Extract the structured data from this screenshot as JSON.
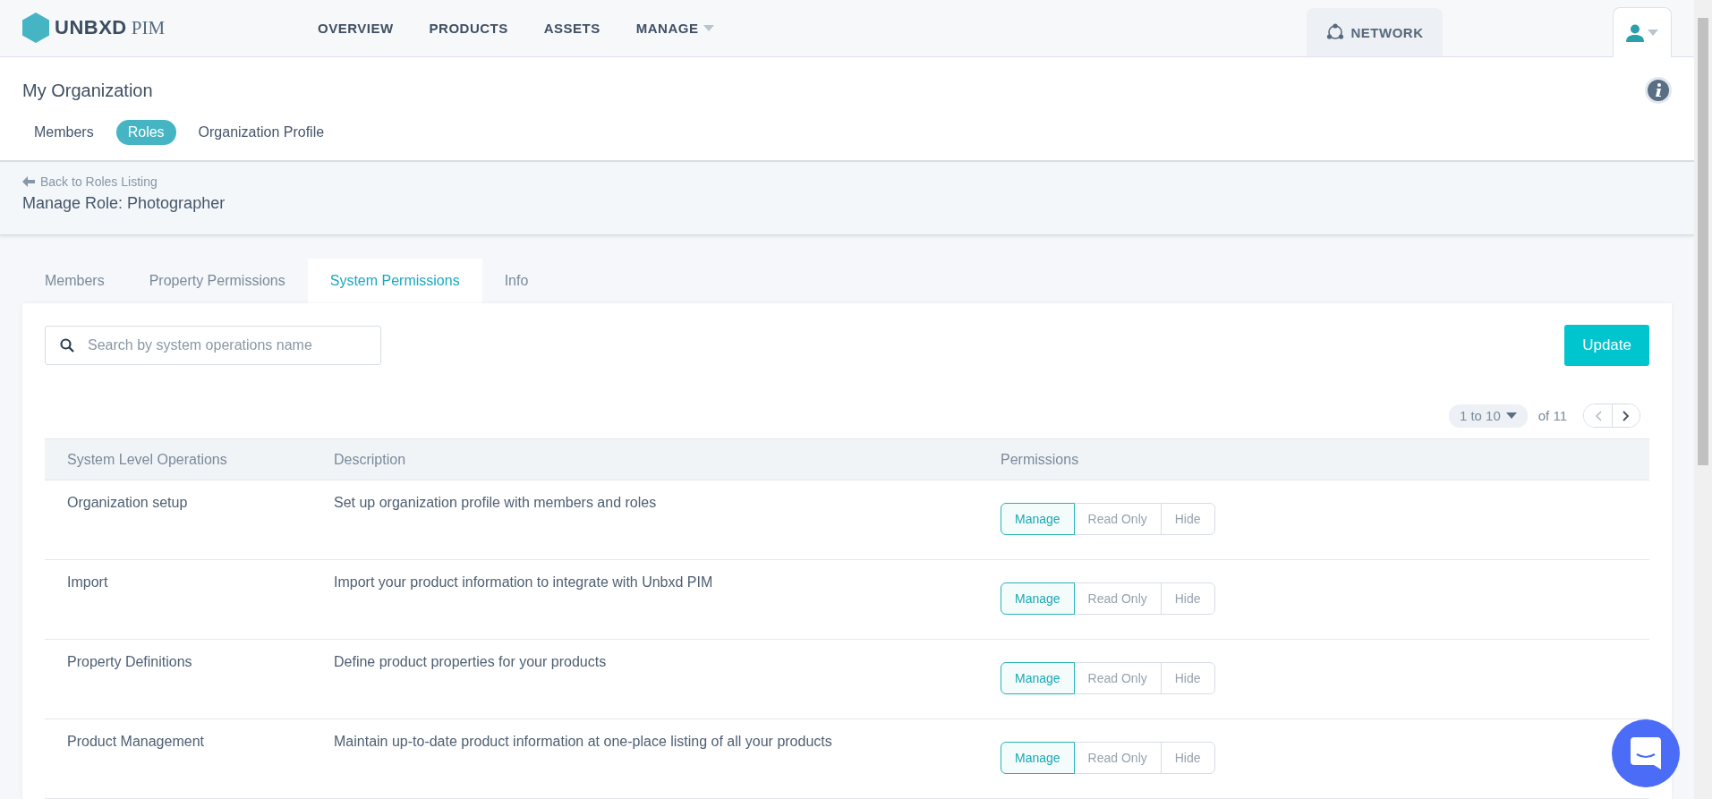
{
  "brand": {
    "name": "UNBXD",
    "suffix": "PIM"
  },
  "nav": [
    {
      "label": "OVERVIEW",
      "dropdown": false
    },
    {
      "label": "PRODUCTS",
      "dropdown": false
    },
    {
      "label": "ASSETS",
      "dropdown": false
    },
    {
      "label": "MANAGE",
      "dropdown": true
    }
  ],
  "network": {
    "label": "NETWORK"
  },
  "page_title": "My Organization",
  "org_tabs": [
    {
      "label": "Members",
      "selected": false
    },
    {
      "label": "Roles",
      "selected": true
    },
    {
      "label": "Organization Profile",
      "selected": false
    }
  ],
  "back_link": "Back to Roles Listing",
  "role_title": "Manage Role: Photographer",
  "role_tabs": [
    {
      "label": "Members",
      "selected": false
    },
    {
      "label": "Property Permissions",
      "selected": false
    },
    {
      "label": "System Permissions",
      "selected": true
    },
    {
      "label": "Info",
      "selected": false
    }
  ],
  "search": {
    "placeholder": "Search by system operations name"
  },
  "update_button": "Update",
  "pagination": {
    "range": "1 to 10",
    "total": "of 11"
  },
  "table": {
    "columns": [
      "System Level Operations",
      "Description",
      "Permissions"
    ],
    "rows": [
      {
        "operation": "Organization setup",
        "description": "Set up organization profile with members and roles",
        "options": [
          {
            "label": "Manage",
            "selected": true
          },
          {
            "label": "Read Only",
            "selected": false
          },
          {
            "label": "Hide",
            "selected": false
          }
        ]
      },
      {
        "operation": "Import",
        "description": "Import your product information to integrate with Unbxd PIM",
        "options": [
          {
            "label": "Manage",
            "selected": true
          },
          {
            "label": "Read Only",
            "selected": false
          },
          {
            "label": "Hide",
            "selected": false
          }
        ]
      },
      {
        "operation": "Property Definitions",
        "description": "Define product properties for your products",
        "options": [
          {
            "label": "Manage",
            "selected": true
          },
          {
            "label": "Read Only",
            "selected": false
          },
          {
            "label": "Hide",
            "selected": false
          }
        ]
      },
      {
        "operation": "Product Management",
        "description": "Maintain up-to-date product information at one-place listing of all your products",
        "options": [
          {
            "label": "Manage",
            "selected": true
          },
          {
            "label": "Read Only",
            "selected": false
          },
          {
            "label": "Hide",
            "selected": false
          }
        ]
      }
    ]
  }
}
